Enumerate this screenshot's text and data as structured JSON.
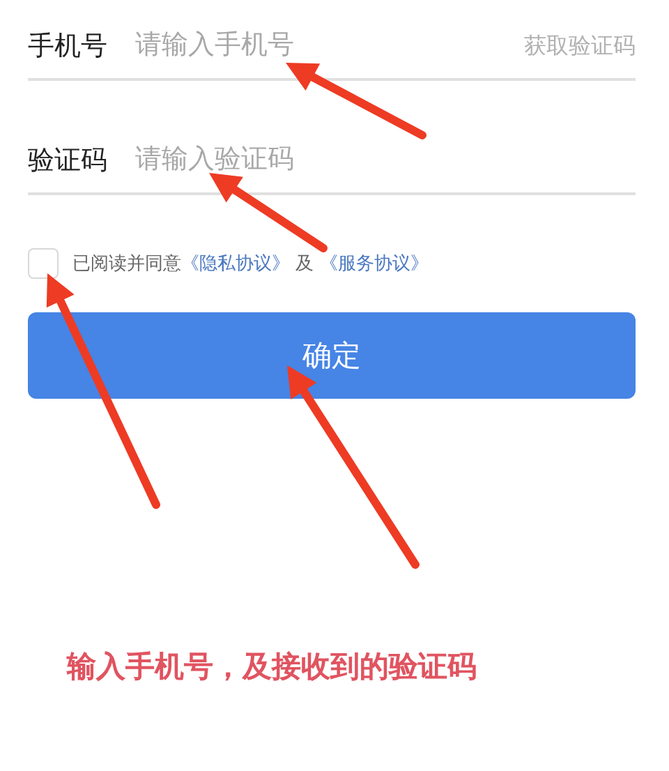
{
  "phone_field": {
    "label": "手机号",
    "placeholder": "请输入手机号",
    "action": "获取验证码"
  },
  "code_field": {
    "label": "验证码",
    "placeholder": "请输入验证码"
  },
  "agreement": {
    "checked": false,
    "text": "已阅读并同意",
    "link_1": "《隐私协议》",
    "joiner": "及",
    "link_2": "《服务协议》"
  },
  "confirm_button": "确定",
  "caption": "输入手机号，及接收到的验证码"
}
